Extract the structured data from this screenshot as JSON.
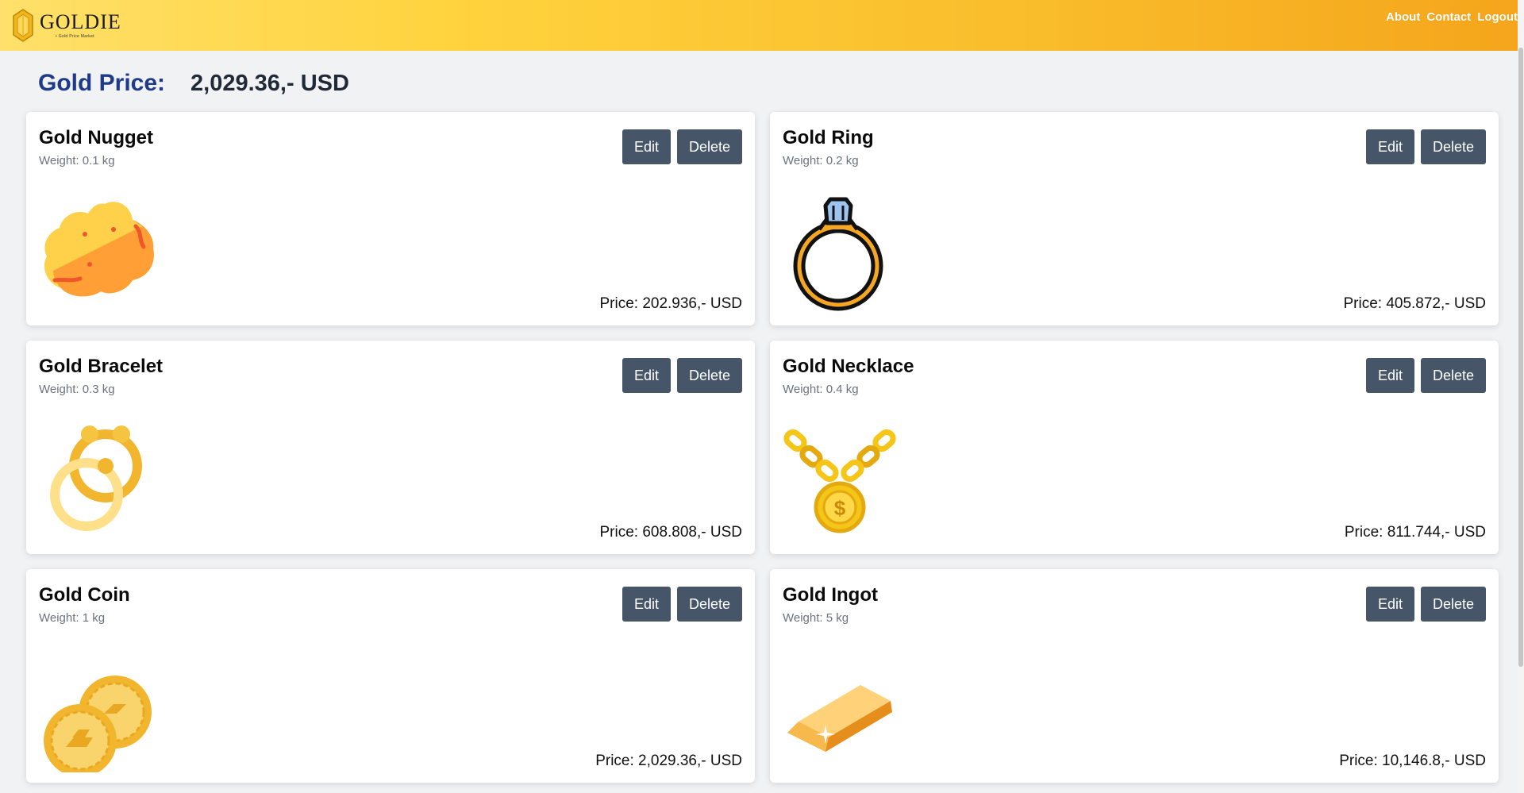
{
  "brand": {
    "name": "GOLDIE",
    "tagline": "• Gold Price Market"
  },
  "nav": {
    "about": "About",
    "contact": "Contact",
    "logout": "Logout"
  },
  "gold_price": {
    "label": "Gold Price:",
    "value": "2,029.36,- USD"
  },
  "colors": {
    "header_start": "#ffe06a",
    "header_end": "#f5a51b",
    "price_label": "#1e3a8a",
    "button_bg": "#475569"
  },
  "items": [
    {
      "name": "Gold Nugget",
      "weight": "Weight: 0.1 kg",
      "price": "Price: 202.936,- USD",
      "icon": "gold-nugget-icon",
      "edit": "Edit",
      "delete": "Delete"
    },
    {
      "name": "Gold Ring",
      "weight": "Weight: 0.2 kg",
      "price": "Price: 405.872,- USD",
      "icon": "gold-ring-icon",
      "edit": "Edit",
      "delete": "Delete"
    },
    {
      "name": "Gold Bracelet",
      "weight": "Weight: 0.3 kg",
      "price": "Price: 608.808,- USD",
      "icon": "gold-bracelet-icon",
      "edit": "Edit",
      "delete": "Delete"
    },
    {
      "name": "Gold Necklace",
      "weight": "Weight: 0.4 kg",
      "price": "Price: 811.744,- USD",
      "icon": "gold-necklace-icon",
      "edit": "Edit",
      "delete": "Delete"
    },
    {
      "name": "Gold Coin",
      "weight": "Weight: 1 kg",
      "price": "Price: 2,029.36,- USD",
      "icon": "gold-coin-icon",
      "edit": "Edit",
      "delete": "Delete"
    },
    {
      "name": "Gold Ingot",
      "weight": "Weight: 5 kg",
      "price": "Price: 10,146.8,- USD",
      "icon": "gold-ingot-icon",
      "edit": "Edit",
      "delete": "Delete"
    }
  ]
}
